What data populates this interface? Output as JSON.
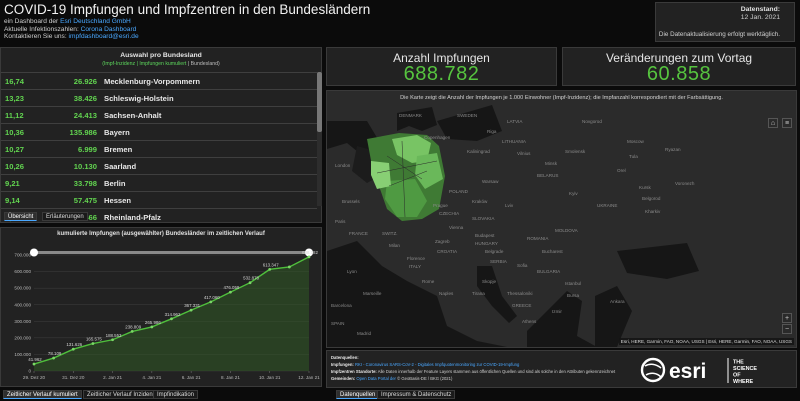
{
  "header": {
    "title": "COVID-19 Impfungen und Impfzentren in den Bundesländern",
    "line1_prefix": "ein Dashboard der ",
    "line1_link": "Esri Deutschland GmbH",
    "line2_prefix": "Aktuelle Infektionszahlen: ",
    "line2_link": "Corona Dashboard",
    "line3_prefix": "Kontaktieren Sie uns: ",
    "line3_link": "impfdashboard@esri.de"
  },
  "date_box": {
    "title": "Datenstand:",
    "value": "12 Jan. 2021",
    "message": "Die Datenaktualisierung erfolgt werktäglich."
  },
  "list": {
    "title": "Auswahl pro Bundesland",
    "subtitle_green": "(Impf-Inzidenz | Impfungen kumuliert",
    "subtitle_rest": " | Bundesland)",
    "rows": [
      {
        "rate": "16,74",
        "count": "26.926",
        "state": "Mecklenburg-Vorpommern"
      },
      {
        "rate": "13,23",
        "count": "38.426",
        "state": "Schleswig-Holstein"
      },
      {
        "rate": "11,12",
        "count": "24.413",
        "state": "Sachsen-Anhalt"
      },
      {
        "rate": "10,36",
        "count": "135.986",
        "state": "Bayern"
      },
      {
        "rate": "10,27",
        "count": "6.999",
        "state": "Bremen"
      },
      {
        "rate": "10,26",
        "count": "10.130",
        "state": "Saarland"
      },
      {
        "rate": "9,21",
        "count": "33.798",
        "state": "Berlin"
      },
      {
        "rate": "9,14",
        "count": "57.475",
        "state": "Hessen"
      },
      {
        "rate": "8,91",
        "count": "36.466",
        "state": "Rheinland-Pfalz"
      }
    ],
    "tabs": [
      "Übersicht",
      "Erläuterungen"
    ]
  },
  "kpi": {
    "impfungen_label": "Anzahl Impfungen",
    "impfungen_value": "688.782",
    "veraenderung_label": "Veränderungen zum Vortag",
    "veraenderung_value": "60.858"
  },
  "map": {
    "caption": "Die Karte zeigt die Anzahl der Impfungen je 1.000 Einwohner (Impf-Inzidenz); die Impfanzahl korrespondiert mit der Farbsättigung.",
    "labels": {
      "denmark": "DENMARK",
      "latvia": "LATVIA",
      "novgorod": "Novgorod",
      "lithuania": "LITHUANIA",
      "moscow": "Moscow",
      "vilnius": "Vilnius",
      "minsk": "Minsk",
      "belarus": "BELARUS",
      "smolensk": "Smolensk",
      "tula": "Tula",
      "ryazan": "Ryazan",
      "orel": "Orel",
      "voronezh": "Voronezh",
      "kursk": "Kursk",
      "belgorod": "Belgorod",
      "kharkiv": "Kharkiv",
      "ukraine": "UKRAINE",
      "kyiv": "Kyiv",
      "warsaw": "Warsaw",
      "poland": "POLAND",
      "krakow": "Kraków",
      "lviv": "Lviv",
      "prague": "Prague",
      "czechia": "CZECHIA",
      "slovakia": "SLOVAKIA",
      "vienna": "Vienna",
      "budapest": "Budapest",
      "hungary": "HUNGARY",
      "moldova": "MOLDOVA",
      "romania": "ROMANIA",
      "bucharest": "Bucharest",
      "serbia": "SERBIA",
      "belgrade": "Belgrade",
      "sofia": "Sofia",
      "bulgaria": "BULGARIA",
      "tirana": "Tirana",
      "skopje": "Skopje",
      "thessaloniki": "Thessaloniki",
      "greece": "GREECE",
      "athens": "Athens",
      "istanbul": "Istanbul",
      "bursa": "Bursa",
      "izmir": "Izmir",
      "ankara": "Ankara",
      "rome": "Rome",
      "naples": "Naples",
      "italy": "ITALY",
      "florence": "Florence",
      "milan": "Milan",
      "switzerland": "SWITZ.",
      "zagreb": "Zagreb",
      "croatia": "CROATIA",
      "brussels": "Brussels",
      "paris": "Paris",
      "london": "London",
      "lyon": "Lyon",
      "france": "FRANCE",
      "marseille": "Marseille",
      "madrid": "Madrid",
      "spain": "SPAIN",
      "barcelona": "Barcelona",
      "kaliningrad": "Kaliningrad",
      "copenhagen": "Copenhagen",
      "sweden": "SWEDEN",
      "riga": "Riga"
    },
    "attribution": "Esri, HERE, Garmin, FAO, NOAA, USGS | Esri, HERE, Garmin, FAO, NOAA, USGS",
    "zoom_in": "+",
    "zoom_out": "−",
    "home_icon": "home-icon",
    "list_icon": "list-icon",
    "tabs": [
      "Datenquellen",
      "Impressum & Datenschutz"
    ]
  },
  "sources": {
    "title": "Datenquellen:",
    "impfungen_label": "Impfungen:",
    "impfungen_text": "RKI - Coronavirus SARS-CoV-2 - Digitales Impfquotenmonitoring zur COVID-19-Impfung",
    "impfzentren_label": "Impfzentren Standorte:",
    "impfzentren_text": "Alle Daten innerhalb der Feature Layers stammen aus öffentlichen Quellen und sind als solche in den Attributen gekennzeichnet",
    "gemeinden_label": "Gemeinden:",
    "gemeinden_link": "Open Data Portal der",
    "gemeinden_rest": " © GeoBasis-DE / BKG (2021)"
  },
  "esri": {
    "word": "esri",
    "tagline1": "THE",
    "tagline2": "SCIENCE",
    "tagline3": "OF",
    "tagline4": "WHERE"
  },
  "chart_panel": {
    "tabs": [
      "Zeitlicher Verlauf kumuliert",
      "Zeitlicher Verlauf Inzidenz",
      "Impfindikation"
    ]
  },
  "colors": {
    "green": "#56c43f",
    "link": "#4aa8ff",
    "panel": "#222222",
    "background": "#0b0b0b"
  },
  "chart_data": {
    "type": "line",
    "title": "kumulierte Impfungen (ausgewählter) Bundesländer im zeitlichen Verlauf",
    "x": [
      "29. Dez 20",
      "30. Dez 20",
      "31. Dez 20",
      "1. Jan 21",
      "2. Jan 21",
      "3. Jan 21",
      "4. Jan 21",
      "5. Jan 21",
      "6. Jan 21",
      "7. Jan 21",
      "8. Jan 21",
      "9. Jan 21",
      "10. Jan 21",
      "11. Jan 21",
      "12. Jan 21"
    ],
    "xtick_labels": [
      "29. Dez 20",
      "31. Dez 20",
      "2. Jan 21",
      "4. Jan 21",
      "6. Jan 21",
      "8. Jan 21",
      "10. Jan 21",
      "12. Jan 21"
    ],
    "series": [
      {
        "values": [
          41962,
          78109,
          131626,
          165575,
          188553,
          238809,
          265986,
          314962,
          367331,
          417060,
          476059,
          532878,
          613347,
          627924,
          688782
        ]
      }
    ],
    "data_labels": [
      "41.962",
      "78.109",
      "131.626",
      "165.575",
      "188.553",
      "238.809",
      "265.986",
      "314.962",
      "367.331",
      "417.060",
      "476.059",
      "532.878",
      "613.347",
      "",
      "688.782"
    ],
    "ytick_labels": [
      "0",
      "100.000",
      "200.000",
      "300.000",
      "400.000",
      "500.000",
      "600.000",
      "700.000"
    ],
    "ylim": [
      0,
      700000
    ],
    "grid": true
  }
}
